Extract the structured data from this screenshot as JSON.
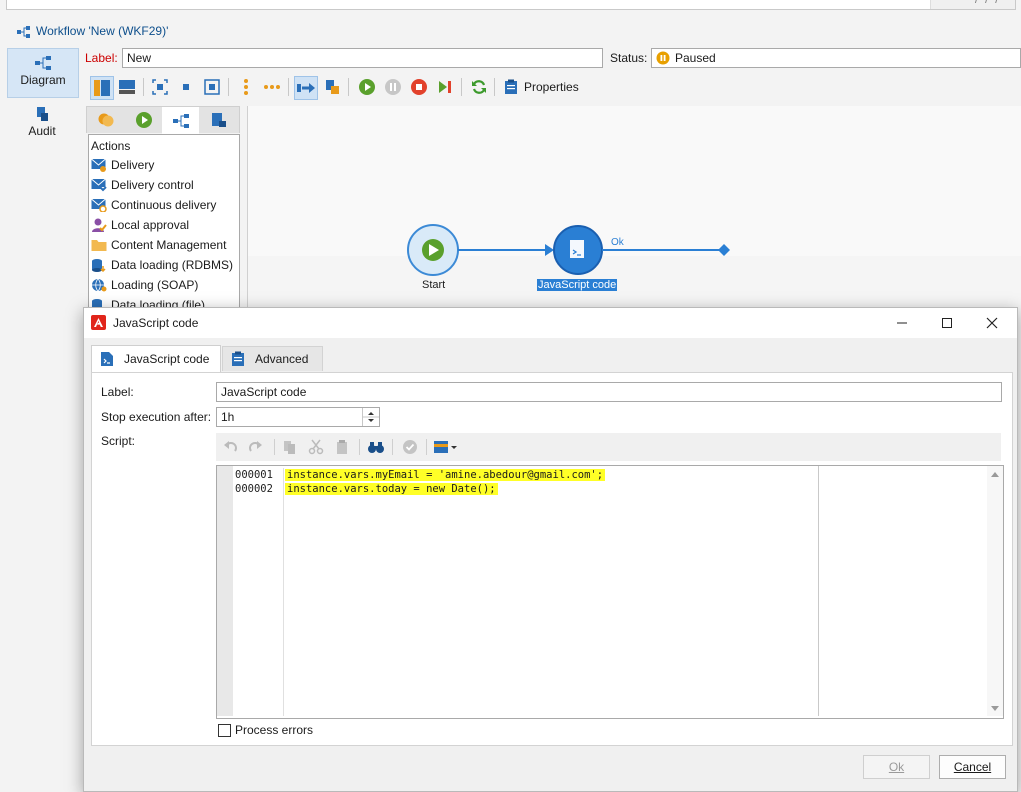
{
  "workflow": {
    "title": "Workflow 'New (WKF29)'",
    "label_caption": "Label:",
    "label_value": "New",
    "status_caption": "Status:",
    "status_value": "Paused"
  },
  "leftnav": {
    "items": [
      {
        "label": "Diagram",
        "icon": "diagram-icon"
      },
      {
        "label": "Audit",
        "icon": "audit-icon"
      }
    ]
  },
  "toolbar": {
    "properties_label": "Properties"
  },
  "palette": {
    "category": "Actions",
    "items": [
      {
        "label": "Delivery",
        "icon": "delivery-icon"
      },
      {
        "label": "Delivery control",
        "icon": "delivery-control-icon"
      },
      {
        "label": "Continuous delivery",
        "icon": "continuous-delivery-icon"
      },
      {
        "label": "Local approval",
        "icon": "local-approval-icon"
      },
      {
        "label": "Content Management",
        "icon": "folder-icon"
      },
      {
        "label": "Data loading (RDBMS)",
        "icon": "database-icon"
      },
      {
        "label": "Loading (SOAP)",
        "icon": "globe-icon"
      },
      {
        "label": "Data loading (file)",
        "icon": "file-icon"
      }
    ]
  },
  "canvas": {
    "start_label": "Start",
    "js_node_label": "JavaScript code",
    "transition_label": "Ok"
  },
  "dialog": {
    "title": "JavaScript code",
    "tabs": [
      {
        "label": "JavaScript code",
        "active": true
      },
      {
        "label": "Advanced",
        "active": false
      }
    ],
    "label_caption": "Label:",
    "label_value": "JavaScript code",
    "stop_caption": "Stop execution after:",
    "stop_value": "1h",
    "script_caption": "Script:",
    "script": {
      "line_numbers": [
        "000001",
        "000002"
      ],
      "lines": [
        "instance.vars.myEmail = 'amine.abedour@gmail.com';",
        "instance.vars.today = new Date();"
      ]
    },
    "process_errors_label": "Process errors",
    "process_errors_checked": false,
    "ok_label": "Ok",
    "cancel_label": "Cancel"
  },
  "colors": {
    "accent": "#2a7fd4",
    "highlight": "#ffff27",
    "status_paused": "#e8a000",
    "start_green": "#5aa02c",
    "adobe_red": "#e1251b"
  }
}
